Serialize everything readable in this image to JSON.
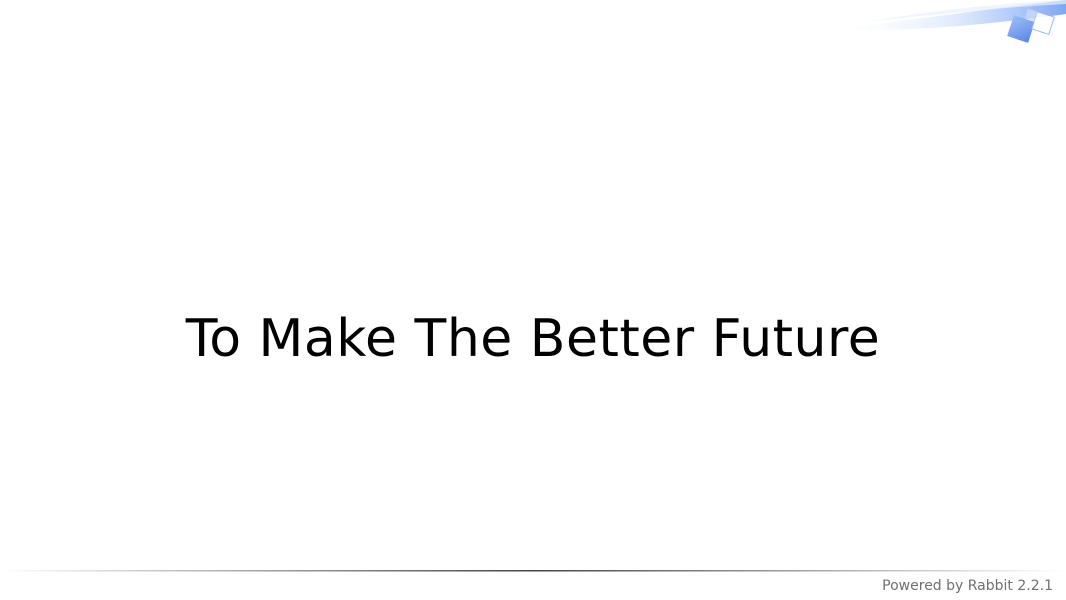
{
  "slide": {
    "title": "To Make The Better Future"
  },
  "footer": {
    "credit": "Powered by Rabbit 2.2.1"
  },
  "colors": {
    "title_text": "#000000",
    "footer_text": "#707070",
    "accent_blue": "#6f9cf0",
    "footer_rule": "#444444"
  },
  "icons": {
    "corner": "blue-swoosh-decoration-icon"
  }
}
